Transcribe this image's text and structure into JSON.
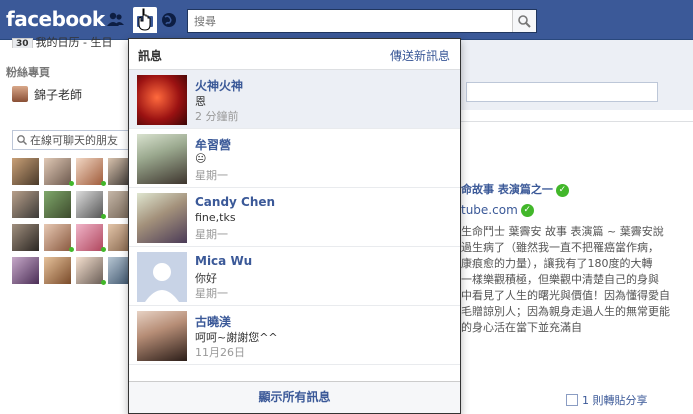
{
  "topbar": {
    "logo": "facebook",
    "search_placeholder": "搜尋"
  },
  "sidebar": {
    "birthday_count": "30",
    "birthday_text": "我的日历 - 生日",
    "fans_title": "粉絲專頁",
    "page_item": "錦子老師",
    "chat_search_placeholder": "在線可聊天的朋友"
  },
  "messages": {
    "title": "訊息",
    "new_message": "傳送新訊息",
    "items": [
      {
        "name": "火神火神",
        "snippet": "恩",
        "time": "2 分鐘前",
        "unread": true
      },
      {
        "name": "牟習營",
        "snippet": "😐",
        "time": "星期一",
        "unread": false
      },
      {
        "name": "Candy Chen",
        "snippet": "fine,tks",
        "time": "星期一",
        "unread": false
      },
      {
        "name": "Mica Wu",
        "snippet": "你好",
        "time": "星期一",
        "unread": false
      },
      {
        "name": "古曉渼",
        "snippet": "呵呵~謝謝您^^",
        "time": "11月26日",
        "unread": false
      }
    ],
    "show_all": "顯示所有訊息"
  },
  "post": {
    "title": "命故事 表演篇之一",
    "link": "tube.com",
    "body": "生命鬥士 葉霽安 故事 表演篇 ~ 葉霽安說\n過生病了（雖然我一直不把罹癌當作病，\n康痕愈的力量），讓我有了180度的大轉\n一樣樂觀積極，但樂觀中清楚自己的身與\n中看見了人生的曙光與價值！因為懂得愛自\n毛贈諒別人；因為親身走過人生的無常更能\n的身心活在當下並充滿自",
    "shares": "1 則轉貼分享"
  }
}
